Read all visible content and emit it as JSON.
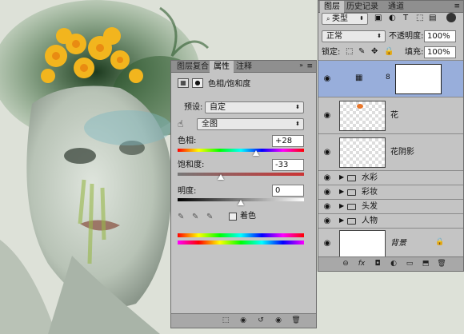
{
  "properties_panel": {
    "tabs": [
      "图层复合",
      "属性",
      "注释"
    ],
    "active_tab": "属性",
    "title": "色相/饱和度",
    "preset_label": "预设:",
    "preset_value": "自定",
    "channel_value": "全图",
    "hue_label": "色相:",
    "hue_value": "+28",
    "saturation_label": "饱和度:",
    "saturation_value": "-33",
    "lightness_label": "明度:",
    "lightness_value": "0",
    "colorize_label": "着色"
  },
  "layers_panel": {
    "tabs": [
      "图层",
      "历史记录",
      "通道"
    ],
    "active_tab": "图层",
    "filter_kind": "类型",
    "blend_mode": "正常",
    "opacity_label": "不透明度:",
    "opacity_value": "100%",
    "lock_label": "锁定:",
    "fill_label": "填充:",
    "fill_value": "100%",
    "layers": [
      {
        "name": "",
        "type": "adjustment"
      },
      {
        "name": "花",
        "type": "layer"
      },
      {
        "name": "花阴影",
        "type": "layer"
      },
      {
        "name": "水彩",
        "type": "group"
      },
      {
        "name": "彩妆",
        "type": "group"
      },
      {
        "name": "头发",
        "type": "group"
      },
      {
        "name": "人物",
        "type": "group"
      },
      {
        "name": "背景",
        "type": "background"
      }
    ],
    "bottom_icons": [
      "link-icon",
      "fx-icon",
      "mask-icon",
      "adjustment-icon",
      "group-icon",
      "new-layer-icon",
      "trash-icon"
    ]
  },
  "colors": {
    "panel_bg": "#c4c4c4",
    "selected_row": "#98aedb"
  }
}
